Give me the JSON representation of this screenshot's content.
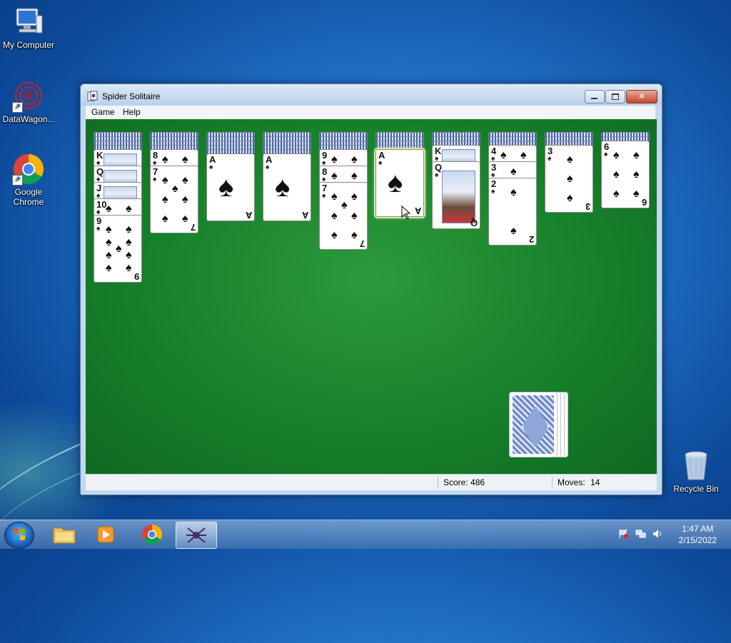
{
  "desktop": {
    "icons": [
      {
        "label": "My Computer"
      },
      {
        "label": "DataWagon..."
      },
      {
        "label": "Google\nChrome"
      },
      {
        "label": "Recycle Bin"
      }
    ]
  },
  "window": {
    "title": "Spider Solitaire",
    "menu": [
      "Game",
      "Help"
    ],
    "buttons": {
      "minimize": "minimize",
      "maximize": "maximize",
      "close": "✕"
    }
  },
  "game": {
    "suit_symbol": "♠",
    "columns": [
      {
        "hidden": 4,
        "cards": [
          "K",
          "Q",
          "J",
          "10",
          "9"
        ]
      },
      {
        "hidden": 4,
        "cards": [
          "8",
          "7"
        ]
      },
      {
        "hidden": 5,
        "cards": [
          "A"
        ]
      },
      {
        "hidden": 5,
        "cards": [
          "A"
        ]
      },
      {
        "hidden": 4,
        "cards": [
          "9",
          "8",
          "7"
        ]
      },
      {
        "hidden": 4,
        "cards": [
          "A"
        ],
        "selected": true
      },
      {
        "hidden": 3,
        "cards": [
          "K",
          "Q"
        ]
      },
      {
        "hidden": 3,
        "cards": [
          "4",
          "3",
          "2"
        ]
      },
      {
        "hidden": 3,
        "cards": [
          "3"
        ]
      },
      {
        "hidden": 2,
        "cards": [
          "6"
        ]
      }
    ],
    "stock_piles": 4
  },
  "status": {
    "score_label": "Score: 486",
    "moves_label": "Moves:",
    "moves_value": "14"
  },
  "taskbar": {
    "time": "1:47 AM",
    "date": "2/15/2022"
  }
}
